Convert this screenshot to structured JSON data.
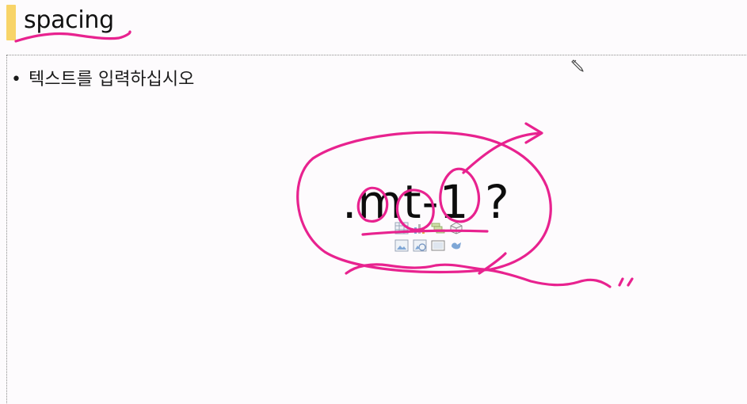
{
  "slide": {
    "title": "spacing",
    "bullet": "텍스트를 입력하십시오",
    "bullet_marker": "•",
    "body_text": ".mt-1 ?"
  },
  "placeholder_icons": [
    "insert-table-icon",
    "insert-chart-icon",
    "insert-smartart-icon",
    "insert-3d-model-icon",
    "insert-picture-icon",
    "insert-online-picture-icon",
    "insert-video-icon",
    "insert-icons-icon"
  ],
  "colors": {
    "accent_bar": "#f8d468",
    "ink": "#e8228f",
    "background": "#fdfbfd",
    "text": "#111111"
  }
}
